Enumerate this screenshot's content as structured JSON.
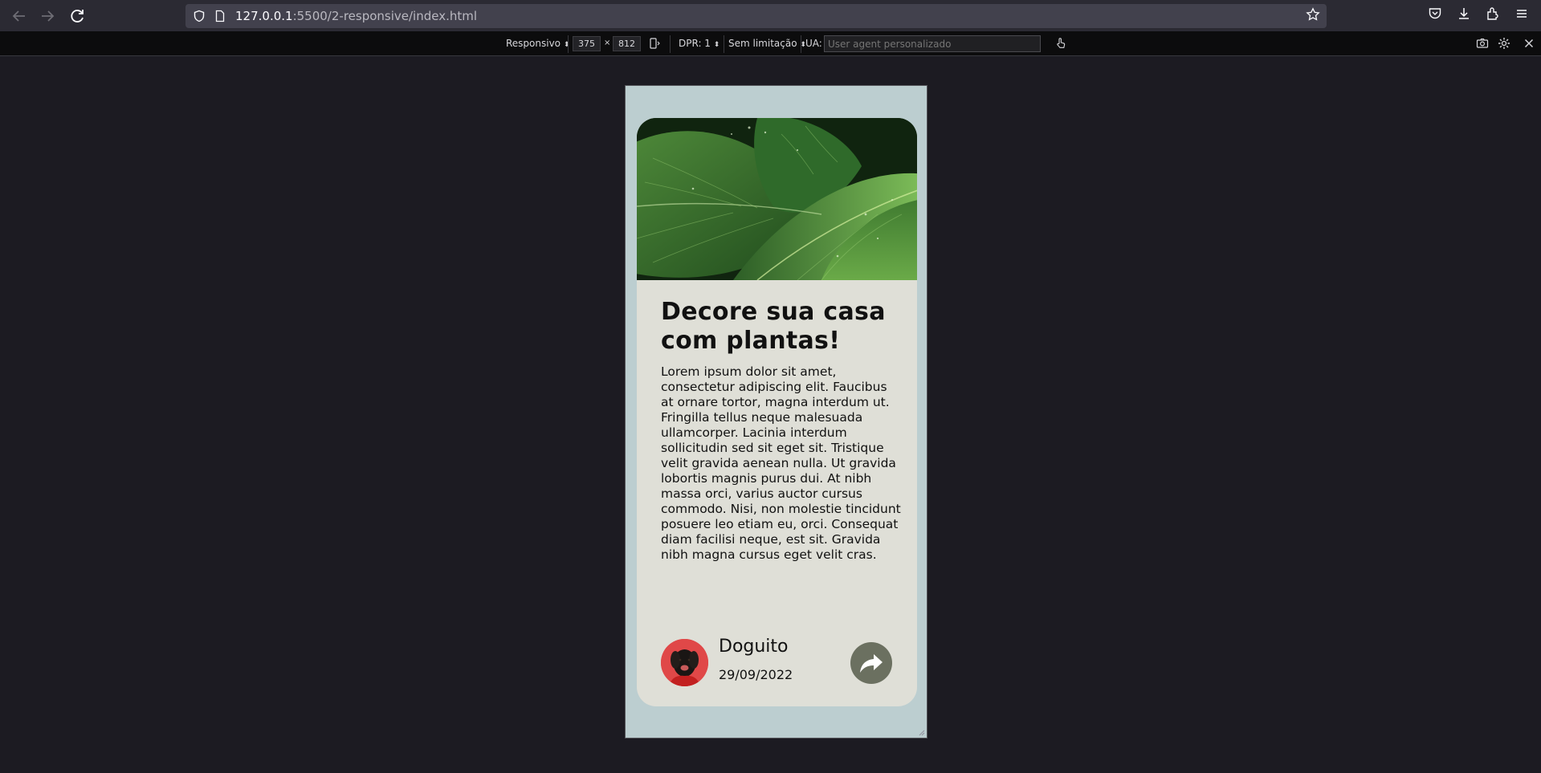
{
  "browser": {
    "url_host": "127.0.0.1",
    "url_path": ":5500/2-responsive/index.html",
    "icons": [
      "back-arrow-icon",
      "forward-arrow-icon",
      "reload-icon",
      "shield-icon",
      "page-icon",
      "bookmark-star-icon",
      "pocket-icon",
      "downloads-icon",
      "extensions-icon",
      "menu-icon"
    ]
  },
  "rdm": {
    "device": "Responsivo",
    "width": "375",
    "times": "×",
    "height": "812",
    "dpr": "DPR: 1",
    "throttle": "Sem limitação",
    "ua_label": "UA:",
    "ua_placeholder": "User agent personalizado"
  },
  "card": {
    "title": "Decore sua casa com plantas!",
    "body": "Lorem ipsum dolor sit amet, consectetur adipiscing elit. Faucibus at ornare tortor, magna interdum ut. Fringilla tellus neque malesuada ullamcorper. Lacinia interdum sollicitudin sed sit eget sit. Tristique velit gravida aenean nulla. Ut gravida lobortis magnis purus dui. At nibh massa orci, varius auctor cursus commodo. Nisi, non molestie tincidunt posuere leo etiam eu, orci. Consequat diam facilisi neque, est sit. Gravida nibh magna cursus eget velit cras.",
    "author": "Doguito",
    "date": "29/09/2022"
  },
  "colors": {
    "page_bg": "#bcced0",
    "card_bg": "#dfdfd7",
    "share_button": "#6b7060",
    "avatar_bg": "#e04848"
  }
}
